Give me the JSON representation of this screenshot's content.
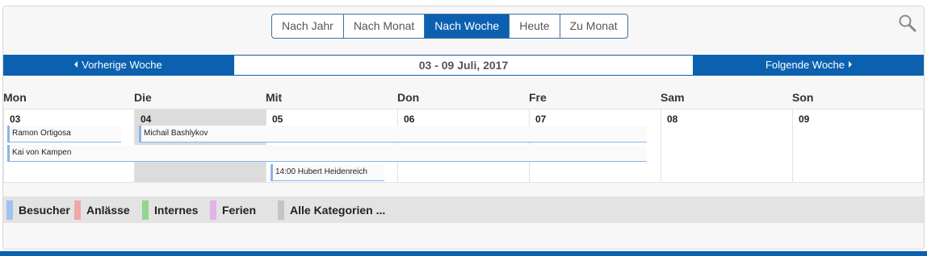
{
  "views": [
    {
      "label": "Nach Jahr",
      "active": false
    },
    {
      "label": "Nach Monat",
      "active": false
    },
    {
      "label": "Nach Woche",
      "active": true
    },
    {
      "label": "Heute",
      "active": false
    },
    {
      "label": "Zu Monat",
      "active": false
    }
  ],
  "search": {
    "icon": "search-icon"
  },
  "nav": {
    "prev_label": "Vorherige Woche",
    "range": "03 - 09 Juli, 2017",
    "next_label": "Folgende Woche"
  },
  "days": [
    {
      "name": "Mon",
      "num": "03",
      "today": false
    },
    {
      "name": "Die",
      "num": "04",
      "today": true
    },
    {
      "name": "Mit",
      "num": "05",
      "today": false
    },
    {
      "name": "Don",
      "num": "06",
      "today": false
    },
    {
      "name": "Fre",
      "num": "07",
      "today": false
    },
    {
      "name": "Sam",
      "num": "08",
      "today": false
    },
    {
      "name": "Son",
      "num": "09",
      "today": false
    }
  ],
  "events": [
    {
      "title": "Ramon Ortigosa"
    },
    {
      "title": "Michail Bashlykov"
    },
    {
      "title": "Kai von Kampen"
    },
    {
      "title": "14:00 Hubert Heidenreich"
    }
  ],
  "legend": [
    {
      "label": "Besucher",
      "color": "#9fc3ef"
    },
    {
      "label": "Anlässe",
      "color": "#f2a5a5"
    },
    {
      "label": "Internes",
      "color": "#93d491"
    },
    {
      "label": "Ferien",
      "color": "#e2b3e6"
    },
    {
      "label": "Alle Kategorien ...",
      "color": "#c4c4c4"
    }
  ],
  "colors": {
    "accent": "#0b61b0",
    "today": "#dcdcdc",
    "event_border": "#8ab4e8"
  }
}
